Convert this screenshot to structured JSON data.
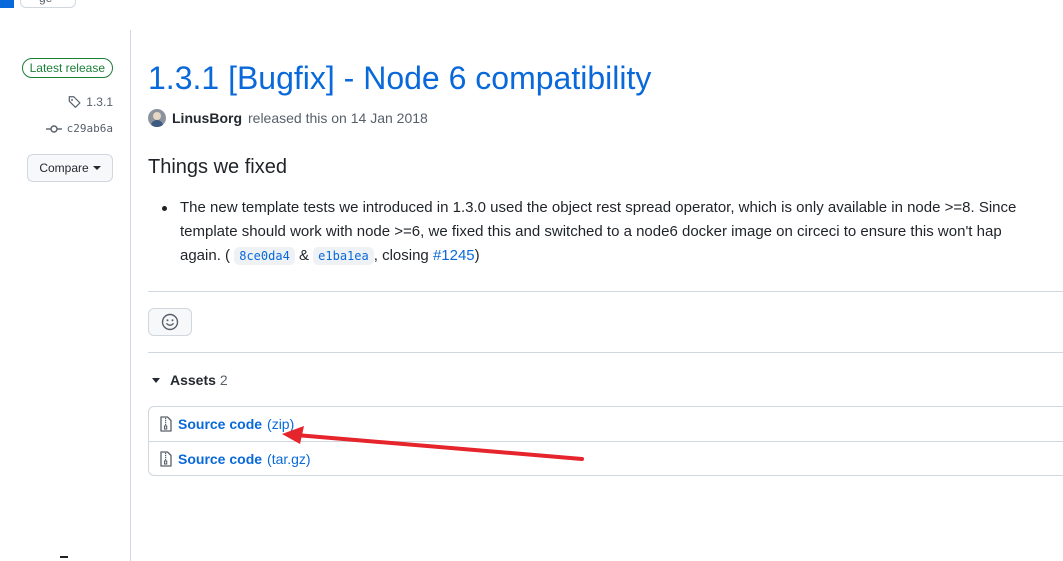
{
  "top": {
    "tab_partial_label": "ge"
  },
  "sidebar": {
    "latest_badge": "Latest release",
    "tag": "1.3.1",
    "commit": "c29ab6a",
    "compare_label": "Compare"
  },
  "release": {
    "title": "1.3.1 [Bugfix] - Node 6 compatibility",
    "author": "LinusBorg",
    "released_text": "released this on 14 Jan 2018",
    "heading": "Things we fixed",
    "notes": {
      "line1": "The new template tests we introduced in 1.3.0 used the object rest spread operator, which is only available in node >=8. Since",
      "line2": "template should work with node >=6, we fixed this and switched to a node6 docker image on circeci to ensure this won't hap",
      "line3_start": "again. (",
      "commit1": "8ce0da4",
      "amp": "&",
      "commit2": "e1ba1ea",
      "closing_text": ", closing",
      "issue_link": "#1245",
      "line3_end": ")"
    }
  },
  "assets": {
    "label": "Assets",
    "count": "2",
    "items": [
      {
        "name": "Source code",
        "ext": "(zip)"
      },
      {
        "name": "Source code",
        "ext": "(tar.gz)"
      }
    ]
  },
  "annotation": {
    "arrow_color": "#e5242b"
  }
}
